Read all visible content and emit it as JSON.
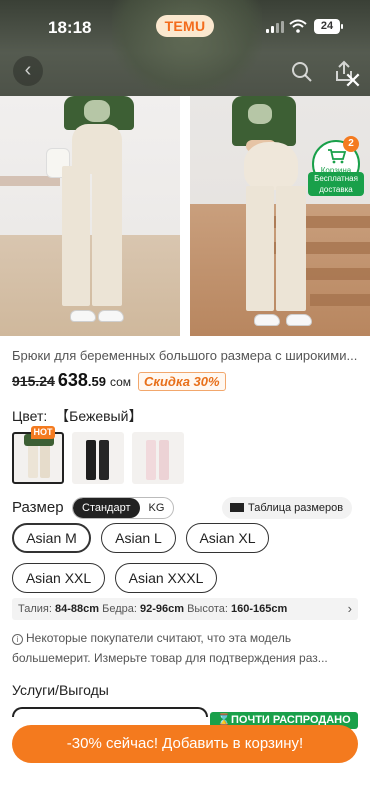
{
  "status_bar": {
    "time": "18:18",
    "battery": "24"
  },
  "header": {
    "logo": "TEMU",
    "back_icon": "chevron-left-icon",
    "search_icon": "search-icon",
    "share_icon": "share-icon",
    "close_icon": "close-icon"
  },
  "gallery": {
    "cart_label": "Корзина",
    "cart_count": "2",
    "free_shipping_line1": "Бесплатная",
    "free_shipping_line2": "доставка"
  },
  "product": {
    "title": "Брюки для беременных большого размера с широкими...",
    "old_price": "915.24",
    "price_main": "638",
    "price_cents": ".59",
    "currency": "сом",
    "discount": "Скидка 30%"
  },
  "color": {
    "label": "Цвет:",
    "value": "【Бежевый】",
    "hot_badge": "HOT",
    "swatches": [
      {
        "name": "beige",
        "hex": "#ece4d6"
      },
      {
        "name": "black",
        "hex": "#1e1e1e"
      },
      {
        "name": "pink",
        "hex": "#f1d9dc"
      }
    ]
  },
  "size": {
    "label": "Размер",
    "toggle": [
      "Стандарт",
      "KG"
    ],
    "chart_label": "Таблица размеров",
    "options": [
      "Asian M",
      "Asian L",
      "Asian XL",
      "Asian XXL",
      "Asian XXXL"
    ],
    "measurements": {
      "waist_label": "Талия:",
      "waist": "84-88cm",
      "hips_label": "Бедра:",
      "hips": "92-96cm",
      "height_label": "Высота:",
      "height": "160-165cm"
    }
  },
  "notice": {
    "line1": "Некоторые покупатели считают, что эта модель",
    "line2": "большемерит. Измерьте товар для подтверждения раз..."
  },
  "services": {
    "label": "Услуги/Выгоды"
  },
  "bottom": {
    "sellout_badge": "ПОЧТИ РАСПРОДАНО",
    "cta": "-30% сейчас! Добавить в корзину!"
  },
  "colors": {
    "accent": "#f47a1e",
    "green": "#19a04a",
    "text": "#222222"
  }
}
